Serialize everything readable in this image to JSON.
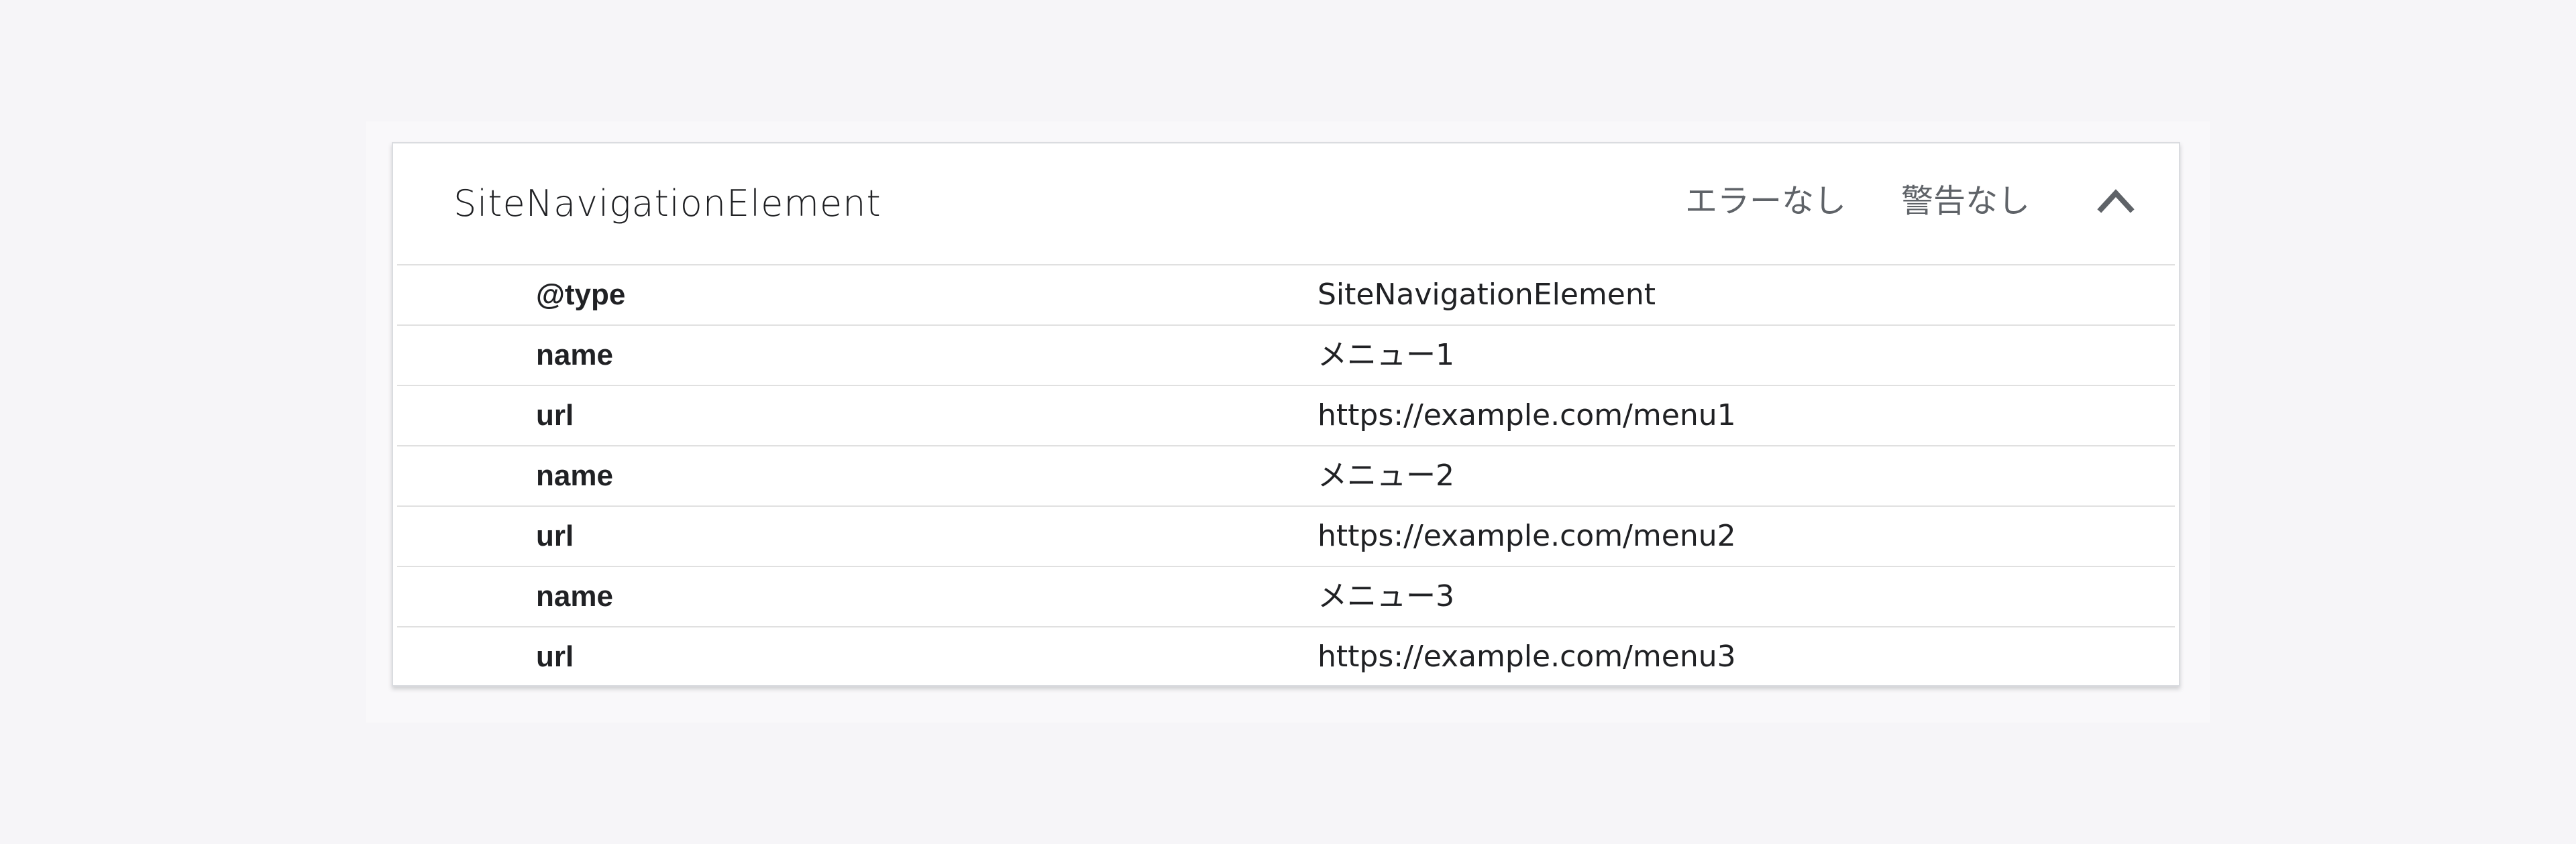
{
  "card": {
    "title": "SiteNavigationElement",
    "errors_status": "エラーなし",
    "warnings_status": "警告なし",
    "collapse_icon": "chevron-up-icon"
  },
  "rows": [
    {
      "key": "@type",
      "value": "SiteNavigationElement"
    },
    {
      "key": "name",
      "value": "メニュー1"
    },
    {
      "key": "url",
      "value": "https://example.com/menu1"
    },
    {
      "key": "name",
      "value": "メニュー2"
    },
    {
      "key": "url",
      "value": "https://example.com/menu2"
    },
    {
      "key": "name",
      "value": "メニュー3"
    },
    {
      "key": "url",
      "value": "https://example.com/menu3"
    }
  ]
}
